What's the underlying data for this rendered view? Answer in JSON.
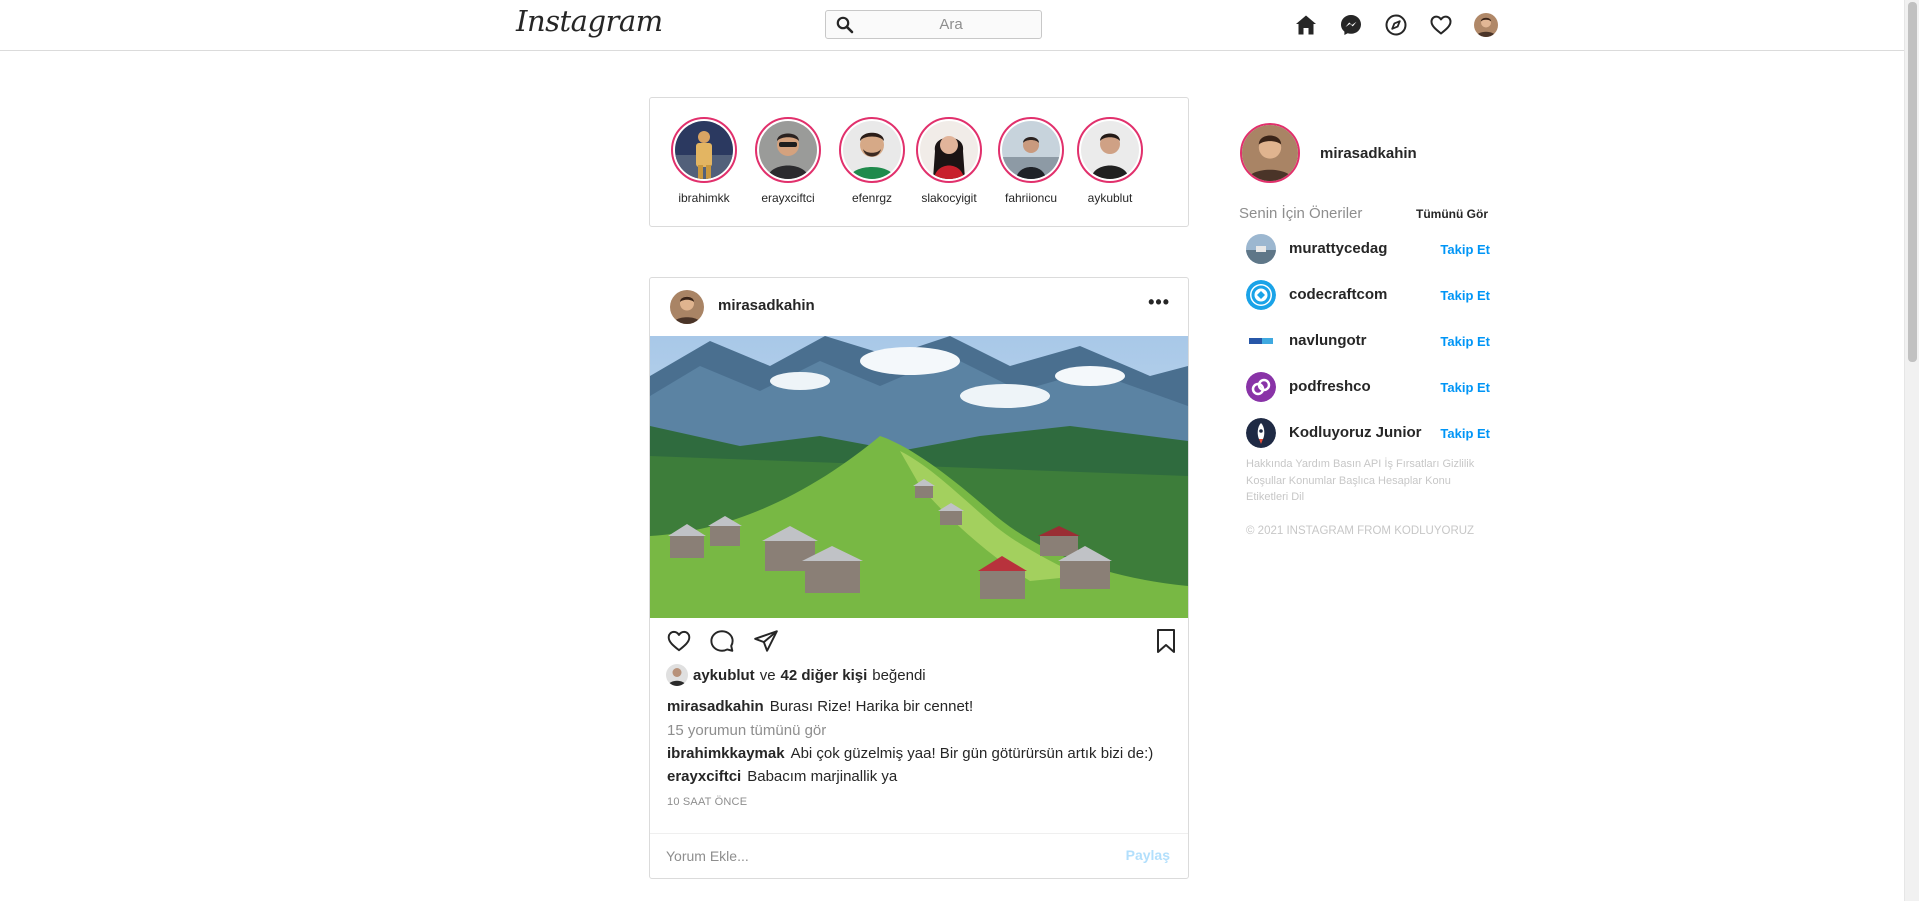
{
  "header": {
    "logo": "Instagram",
    "search_placeholder": "Ara",
    "nav_icons": [
      "home-icon",
      "messenger-icon",
      "explore-icon",
      "heart-icon",
      "profile-avatar"
    ]
  },
  "stories": [
    {
      "username": "ibrahimkk"
    },
    {
      "username": "erayxciftci"
    },
    {
      "username": "efenrgz"
    },
    {
      "username": "slakocyigit"
    },
    {
      "username": "fahriioncu"
    },
    {
      "username": "aykublut"
    }
  ],
  "post": {
    "username": "mirasadkahin",
    "more_label": "•••",
    "likes": {
      "liker": "aykublut",
      "connector": "ve",
      "others": "42 diğer kişi",
      "suffix": "beğendi"
    },
    "caption": {
      "username": "mirasadkahin",
      "text": "Burası Rize! Harika bir cennet!"
    },
    "view_all_comments": "15 yorumun tümünü gör",
    "comments": [
      {
        "username": "ibrahimkkaymak",
        "text": "Abi çok güzelmiş yaa! Bir gün götürürsün artık bizi de:)"
      },
      {
        "username": "erayxciftci",
        "text": "Babacım marjinallik ya"
      }
    ],
    "time": "10 SAAT ÖNCE",
    "comment_placeholder": "Yorum Ekle...",
    "share_label": "Paylaş"
  },
  "sidebar": {
    "username": "mirasadkahin",
    "suggestions_title": "Senin İçin Öneriler",
    "see_all": "Tümünü Gör",
    "suggestions": [
      {
        "username": "murattycedag",
        "action": "Takip Et"
      },
      {
        "username": "codecraftcom",
        "action": "Takip Et"
      },
      {
        "username": "navlungotr",
        "action": "Takip Et"
      },
      {
        "username": "podfreshco",
        "action": "Takip Et"
      },
      {
        "username": "Kodluyoruz Junior",
        "action": "Takip Et"
      }
    ],
    "footer_links": "Hakkında Yardım Basın API İş Fırsatları Gizlilik Koşullar Konumlar Başlıca Hesaplar Konu Etiketleri Dil",
    "copyright": "© 2021 INSTAGRAM FROM KODLUYORUZ"
  },
  "colors": {
    "story_ring": "#e1306c",
    "link_blue": "#0095f6",
    "share_disabled": "#b2dffc",
    "muted": "#8e8e8e",
    "border": "#dbdbdb"
  }
}
